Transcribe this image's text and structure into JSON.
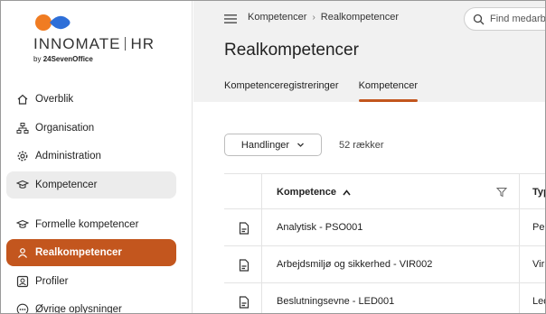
{
  "brand": {
    "name": "INNOMATE",
    "product": "HR",
    "by_prefix": "by",
    "by_company": "24SevenOffice",
    "colors": {
      "orange": "#f07c22",
      "blue": "#2e6fd8",
      "accent": "#c3561e"
    }
  },
  "sidebar": {
    "items": [
      {
        "label": "Overblik",
        "icon": "home-icon"
      },
      {
        "label": "Organisation",
        "icon": "org-chart-icon"
      },
      {
        "label": "Administration",
        "icon": "gear-icon"
      },
      {
        "label": "Kompetencer",
        "icon": "graduation-cap-icon",
        "state": "expanded-group"
      },
      {
        "label": "Formelle kompetencer",
        "icon": "graduation-cap-icon"
      },
      {
        "label": "Realkompetencer",
        "icon": "person-badge-icon",
        "state": "active"
      },
      {
        "label": "Profiler",
        "icon": "profile-card-icon"
      },
      {
        "label": "Øvrige oplysninger",
        "icon": "more-dots-icon"
      }
    ]
  },
  "header": {
    "breadcrumb": [
      "Kompetencer",
      "Realkompetencer"
    ],
    "search_placeholder": "Find medarbejder",
    "title": "Realkompetencer",
    "tabs": [
      {
        "label": "Kompetenceregistreringer",
        "active": false
      },
      {
        "label": "Kompetencer",
        "active": true
      }
    ]
  },
  "toolbar": {
    "actions_label": "Handlinger",
    "row_count": "52 rækker"
  },
  "table": {
    "columns": [
      {
        "label": "Kompetence",
        "sort": "ascending"
      },
      {
        "label": "Typ"
      }
    ],
    "rows": [
      {
        "name": "Analytisk - PSO001",
        "type": "Per"
      },
      {
        "name": "Arbejdsmiljø og sikkerhed - VIR002",
        "type": "Virk"
      },
      {
        "name": "Beslutningsevne - LED001",
        "type": "Led"
      }
    ]
  }
}
